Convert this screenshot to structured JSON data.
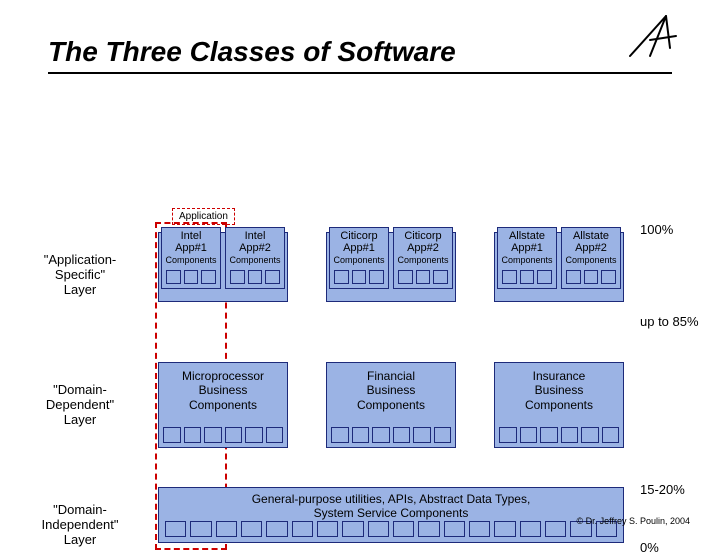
{
  "title": "The Three Classes of Software",
  "application_label": "Application",
  "row_labels": {
    "r1a": "\"Application-",
    "r1b": "Specific\"",
    "r1c": "Layer",
    "r2a": "\"Domain-",
    "r2b": "Dependent\"",
    "r2c": "Layer",
    "r3a": "\"Domain-",
    "r3b": "Independent\"",
    "r3c": "Layer"
  },
  "percentages": {
    "p100": "100%",
    "p85": "up to 85%",
    "p15": "15-20%",
    "p0": "0%"
  },
  "apps": {
    "g1a_l1": "Intel",
    "g1a_l2": "App#1",
    "g1b_l1": "Intel",
    "g1b_l2": "App#2",
    "g2a_l1": "Citicorp",
    "g2a_l2": "App#1",
    "g2b_l1": "Citicorp",
    "g2b_l2": "App#2",
    "g3a_l1": "Allstate",
    "g3a_l2": "App#1",
    "g3b_l1": "Allstate",
    "g3b_l2": "App#2",
    "components": "Components"
  },
  "domains": {
    "d1_l1": "Microprocessor",
    "d1_l2": "Business",
    "d1_l3": "Components",
    "d2_l1": "Financial",
    "d2_l2": "Business",
    "d2_l3": "Components",
    "d3_l1": "Insurance",
    "d3_l2": "Business",
    "d3_l3": "Components"
  },
  "gp": {
    "l1": "General-purpose utilities, APIs, Abstract Data Types,",
    "l2": "System Service Components"
  },
  "copyright": "© Dr. Jeffrey S. Poulin, 2004"
}
